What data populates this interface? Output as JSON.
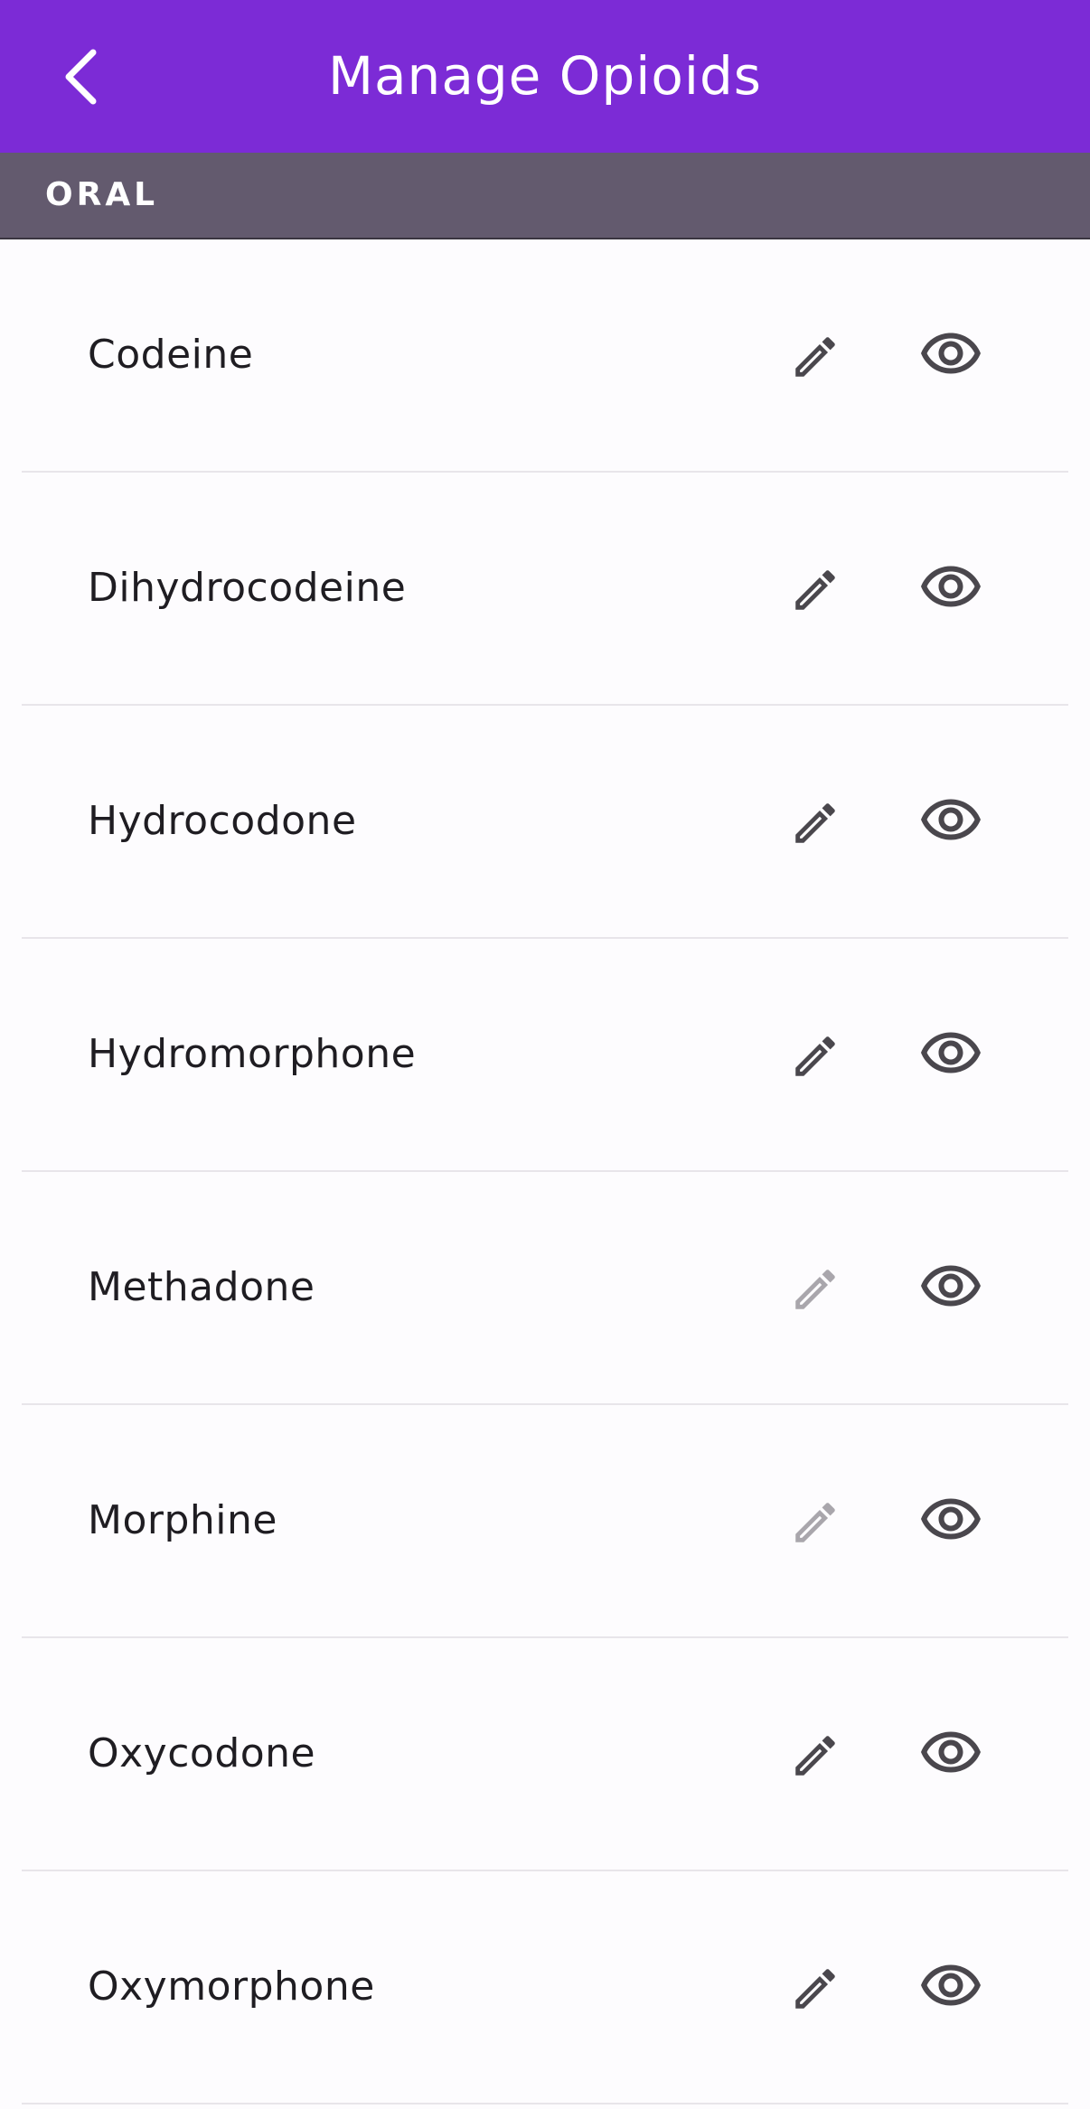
{
  "header": {
    "title": "Manage Opioids",
    "bar_color": "#7c2bd6",
    "back_icon": "chevron-left-icon"
  },
  "section": {
    "label": "ORAL",
    "color": "#635a6e"
  },
  "items": [
    {
      "name": "Codeine",
      "edit_enabled": true
    },
    {
      "name": "Dihydrocodeine",
      "edit_enabled": true
    },
    {
      "name": "Hydrocodone",
      "edit_enabled": true
    },
    {
      "name": "Hydromorphone",
      "edit_enabled": true
    },
    {
      "name": "Methadone",
      "edit_enabled": false
    },
    {
      "name": "Morphine",
      "edit_enabled": false
    },
    {
      "name": "Oxycodone",
      "edit_enabled": true
    },
    {
      "name": "Oxymorphone",
      "edit_enabled": true
    }
  ],
  "icons": {
    "edit": "pencil-icon",
    "view": "eye-icon",
    "active_color": "#4a474d",
    "disabled_color": "#a9a6ac"
  }
}
